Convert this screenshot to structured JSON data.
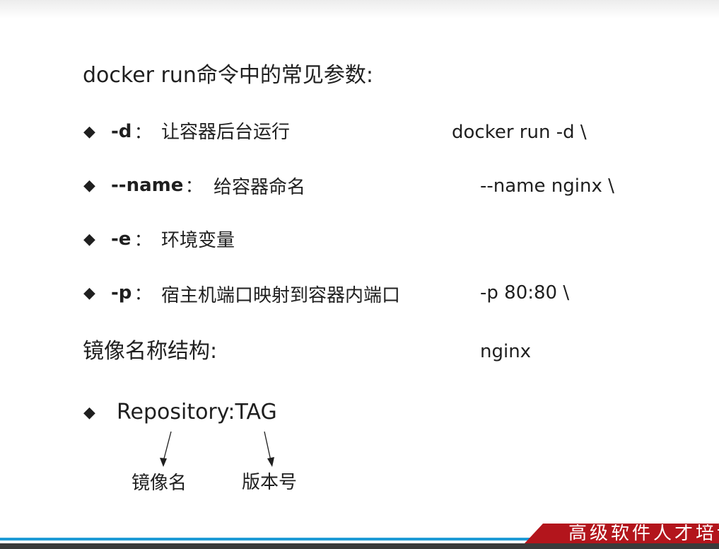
{
  "slide": {
    "title": "docker run命令中的常见参数:",
    "params": [
      {
        "key": "-d",
        "colon": "：",
        "desc": "让容器后台运行"
      },
      {
        "key": "--name",
        "colon": "：",
        "desc": "给容器命名"
      },
      {
        "key": "-e",
        "colon": "：",
        "desc": "环境变量"
      },
      {
        "key": "-p",
        "colon": "：",
        "desc": "宿主机端口映射到容器内端口"
      }
    ],
    "command_lines": [
      "docker run -d \\",
      "--name nginx \\",
      "-p 80:80 \\",
      "nginx"
    ],
    "image_section_title": "镜像名称结构:",
    "image_format": "Repository:TAG",
    "annotations": {
      "repository": "镜像名",
      "tag": "版本号"
    },
    "bullet_symbol": "◆"
  },
  "footer": {
    "badge_text": "高级软件人才培训",
    "colors": {
      "badge": "#b3151c",
      "line_blue": "#1f9bd6",
      "line_dark": "#3a3a3a"
    }
  }
}
